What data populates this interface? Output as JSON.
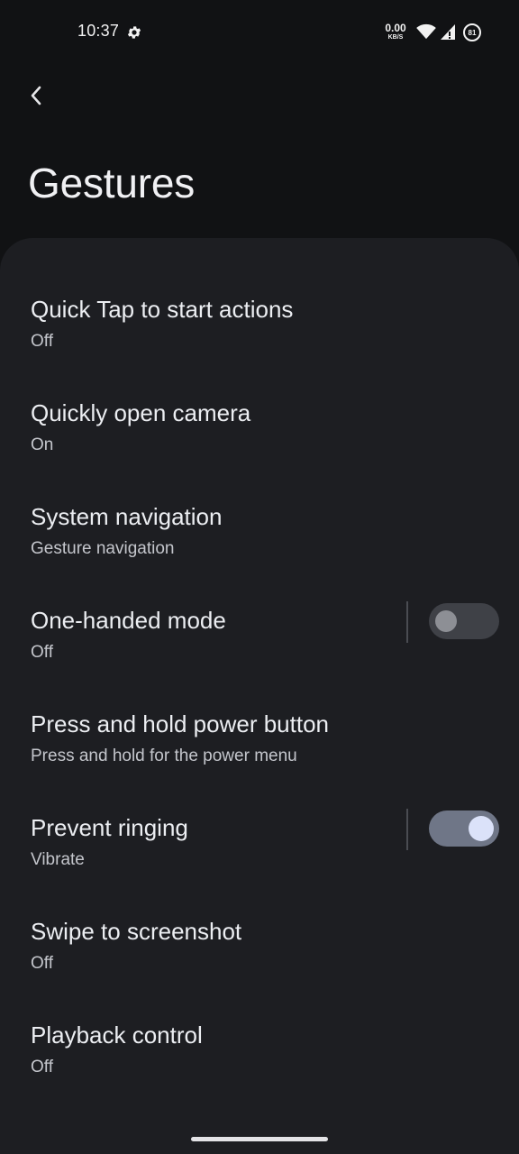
{
  "status_bar": {
    "time": "10:37",
    "net_speed_value": "0.00",
    "net_speed_unit": "KB/S",
    "battery_level": "81"
  },
  "header": {
    "title": "Gestures"
  },
  "settings": [
    {
      "label": "Quick Tap to start actions",
      "summary": "Off"
    },
    {
      "label": "Quickly open camera",
      "summary": "On"
    },
    {
      "label": "System navigation",
      "summary": "Gesture navigation"
    },
    {
      "label": "One-handed mode",
      "summary": "Off",
      "switch_on": false
    },
    {
      "label": "Press and hold power button",
      "summary": "Press and hold for the power menu"
    },
    {
      "label": "Prevent ringing",
      "summary": "Vibrate",
      "switch_on": true
    },
    {
      "label": "Swipe to screenshot",
      "summary": "Off"
    },
    {
      "label": "Playback control",
      "summary": "Off"
    }
  ],
  "colors": {
    "background": "#111214",
    "card": "#1d1e22",
    "switch_on_track": "#6f7687",
    "switch_on_knob": "#dbe2f9",
    "switch_off_track": "#3f4147"
  }
}
